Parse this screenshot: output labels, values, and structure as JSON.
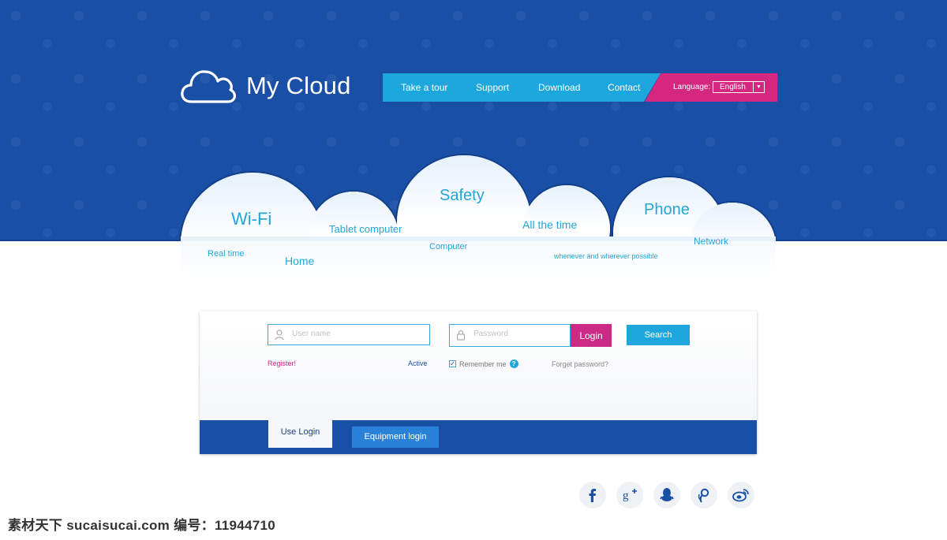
{
  "brand": {
    "name": "My Cloud"
  },
  "nav": {
    "items": [
      "Take a tour",
      "Support",
      "Download",
      "Contact"
    ],
    "language_label": "Language:",
    "language_value": "English"
  },
  "cloud_words": {
    "wifi": "Wi-Fi",
    "real_time": "Real time",
    "home": "Home",
    "tablet": "Tablet computer",
    "safety": "Safety",
    "computer": "Computer",
    "all_the_time": "All the time",
    "whenever": "whenever and wherever possible",
    "phone": "Phone",
    "network": "Network"
  },
  "login": {
    "username_placeholder": "User name",
    "password_placeholder": "Password",
    "login_label": "Login",
    "search_label": "Search",
    "register_label": "Register!",
    "active_label": "Active",
    "remember_label": "Remember me",
    "help_glyph": "?",
    "forgot_label": "Forget password?"
  },
  "tabs": {
    "use_login": "Use Login",
    "equipment_login": "Equipment login"
  },
  "social": [
    "facebook",
    "google-plus",
    "qq",
    "tencent-weibo",
    "sina-weibo"
  ],
  "watermark": "素材天下 sucaisucai.com  编号：11944710",
  "colors": {
    "primary_blue": "#1a4fa6",
    "accent_cyan": "#1ea7dd",
    "accent_magenta": "#d5277f"
  }
}
